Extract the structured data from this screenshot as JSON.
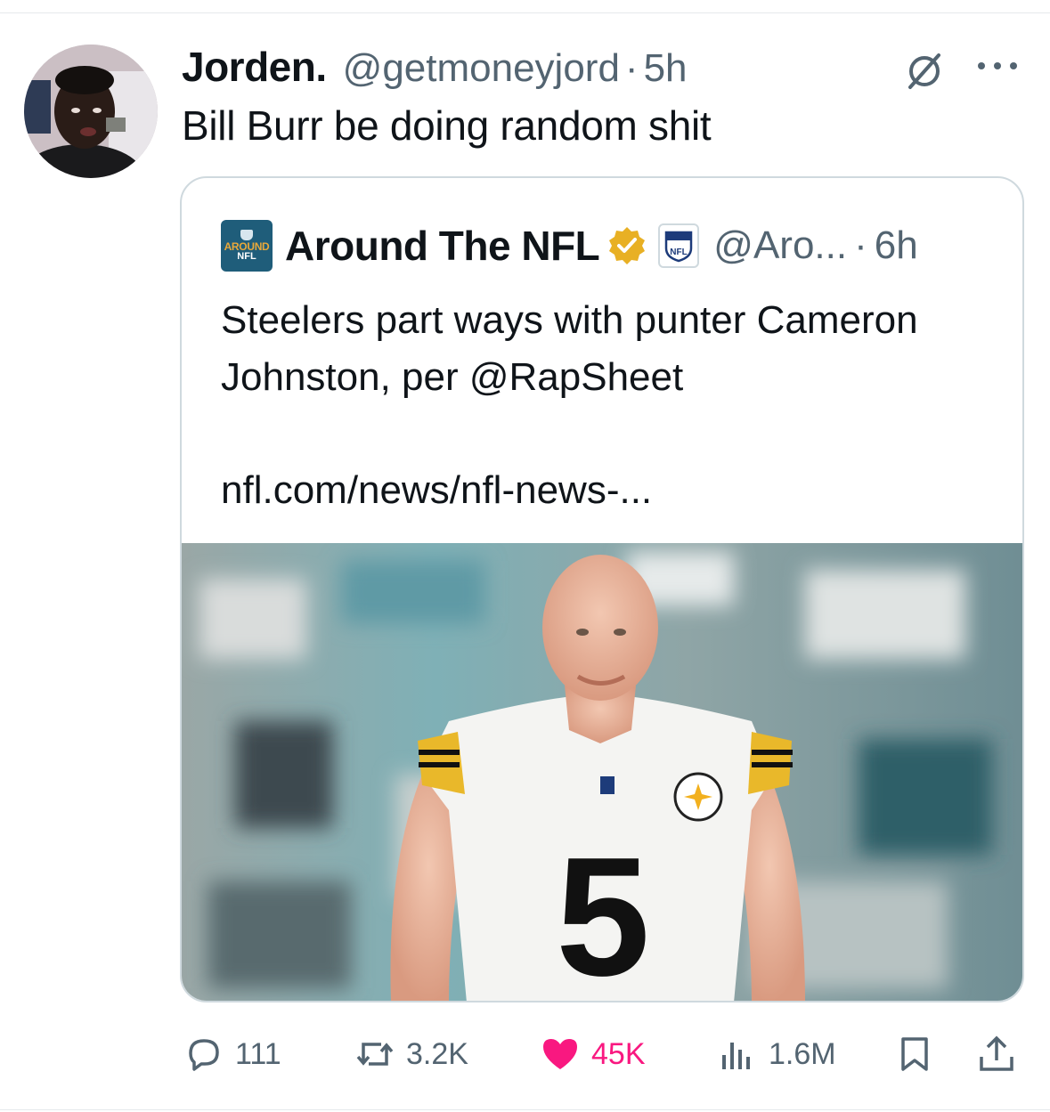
{
  "post": {
    "author_name": "Jorden.",
    "author_handle": "@getmoneyjord",
    "separator": "·",
    "time": "5h",
    "text": "Bill Burr be doing random shit"
  },
  "quoted": {
    "author_name": "Around The NFL",
    "logo_line1": "AROUND",
    "logo_line2": "NFL",
    "affiliate_badge": "NFL",
    "author_handle": "@Aro...",
    "separator": "·",
    "time": "6h",
    "text": "Steelers part ways with punter Cameron Johnston, per @RapSheet",
    "link": "nfl.com/news/nfl-news-...",
    "image": {
      "jersey_number": "5"
    }
  },
  "actions": {
    "replies": "111",
    "reposts": "3.2K",
    "likes": "45K",
    "views": "1.6M"
  },
  "colors": {
    "text": "#0f1419",
    "secondary": "#536471",
    "like": "#f91880",
    "border": "#cfd9de",
    "verified_gold": "#e8b024"
  },
  "icons": [
    "grok-icon",
    "more-icon",
    "verified-badge-icon",
    "reply-icon",
    "repost-icon",
    "heart-icon",
    "views-icon",
    "bookmark-icon",
    "share-icon"
  ]
}
